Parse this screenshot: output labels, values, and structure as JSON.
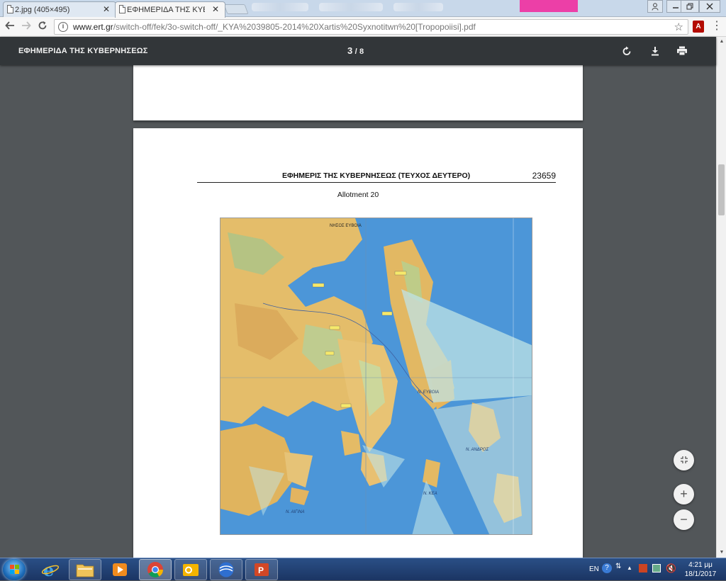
{
  "browser": {
    "tabs": [
      {
        "title": "2.jpg (405×495)",
        "active": false
      },
      {
        "title": "ΕΦΗΜΕΡΙΔΑ ΤΗΣ ΚΥΒΕΡΝ",
        "active": true
      }
    ],
    "close_glyph": "✕",
    "url_host": "www.ert.gr",
    "url_path": "/switch-off/fek/3o-switch-off/_KYA%2039805-2014%20Xartis%20Syxnotitwn%20[Tropopoiisi].pdf"
  },
  "pdf_viewer": {
    "title": "ΕΦΗΜΕΡΙΔΑ ΤΗΣ ΚΥΒΕΡΝΗΣΕΩΣ",
    "current_page": "3",
    "page_separator": "/",
    "total_pages": "8",
    "toolbar_icons": [
      "rotate-icon",
      "download-icon",
      "print-icon"
    ],
    "zoom_controls": {
      "fit": "fit-to-page-icon",
      "zoom_in": "+",
      "zoom_out": "−"
    }
  },
  "document": {
    "header_title": "ΕΦΗΜΕΡΙΣ ΤΗΣ ΚΥΒΕΡΝΗΣΕΩΣ (ΤΕΥΧΟΣ ΔΕΥΤΕΡΟ)",
    "header_page_number": "23659",
    "caption": "Allotment 20",
    "map_labels": {
      "top": "ΝΗΣΟΣ ΕΥΒΟΙΑ",
      "evia": "Ν. ΕΥΒΟΙΑ",
      "andros": "Ν. ΑΝΔΡΟΣ",
      "kea": "Ν. ΚΕΑ",
      "aegina": "Ν. ΑΙΓΙΝΑ"
    }
  },
  "taskbar": {
    "apps": [
      "internet-explorer-icon",
      "file-explorer-icon",
      "media-player-icon",
      "chrome-icon",
      "outlook-icon",
      "earth-icon",
      "powerpoint-icon"
    ],
    "language": "EN",
    "time": "4:21 μμ",
    "date": "18/1/2017"
  },
  "colors": {
    "pdf_toolbar": "#323639",
    "viewer_bg": "#525659",
    "sea": "#4c96d8",
    "land": "#e9c06b",
    "taskbar": "#1b3563"
  }
}
